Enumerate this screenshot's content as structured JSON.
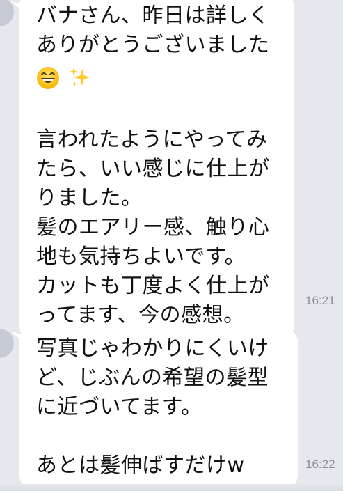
{
  "messages": [
    {
      "lines_before_emoji": [
        "バナさん、昨日は詳しく",
        "ありがとうございました"
      ],
      "emoji": [
        "grinning-face",
        "sparkles"
      ],
      "lines_after_emoji": [
        "言われたようにやってみ",
        "たら、いい感じに仕上が",
        "りました。",
        "髪のエアリー感、触り心",
        "地も気持ちよいです。",
        "カットも丁度よく仕上が",
        "ってます、今の感想。"
      ],
      "time": "16:21"
    },
    {
      "lines": [
        "写真じゃわかりにくいけ",
        "ど、じぶんの希望の髪型",
        "に近づいてます。"
      ],
      "lines_after_blank": [
        "あとは髪伸ばすだけw"
      ],
      "time": "16:22"
    }
  ],
  "colors": {
    "background": "#e6e8ee",
    "bubble": "#ffffff",
    "text": "#111111",
    "timestamp": "#8a8f99"
  }
}
